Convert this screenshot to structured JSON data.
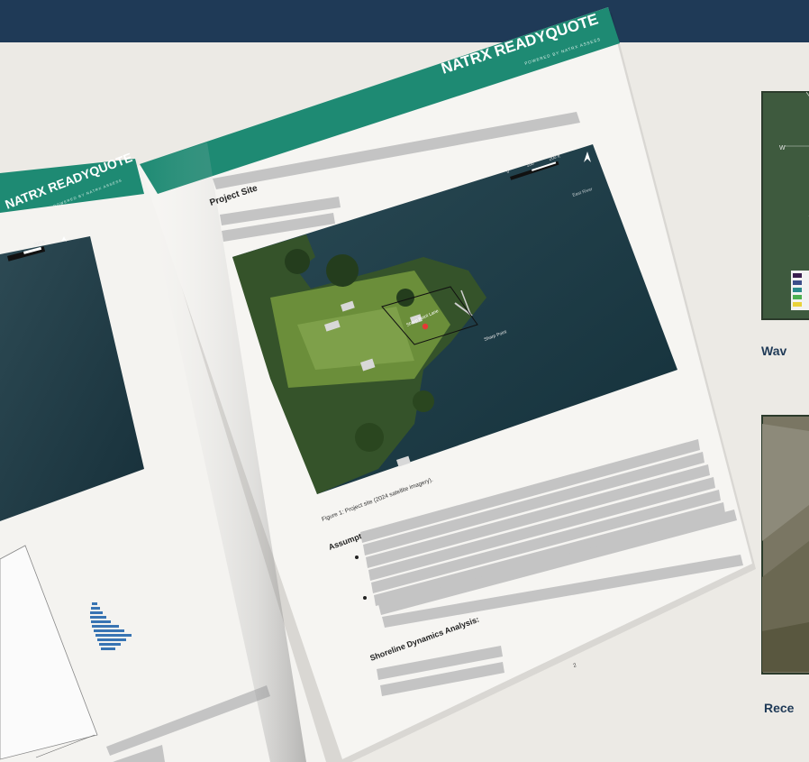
{
  "left_page": {
    "brand": "NATRX READYQUOTE",
    "brand_sub": "POWERED BY NATRX ASSESS",
    "scale_label": "200 ft"
  },
  "right_page": {
    "brand": "NATRX READYQUOTE",
    "brand_sub": "POWERED BY NATRX ASSESS",
    "section_project_site": "Project Site",
    "map_scale_zero": "0",
    "map_scale_mid": "100",
    "map_scale_end": "200 ft",
    "map_label_river": "East River",
    "map_label_point": "Sharp Point",
    "map_label_lane": "Sharp Point Lane",
    "figure_caption": "Figure 1: Project site (2024 satellite imagery).",
    "section_assumptions": "Assumptions",
    "section_shoreline": "Shoreline Dynamics Analysis:",
    "page_number": "2"
  },
  "side_cards": {
    "wave_caption": "Wav",
    "recent_caption": "Rece",
    "compass_w": "W"
  },
  "colors": {
    "header": "#1f3a57",
    "band": "#1e8a73",
    "placeholder": "#c4c4c4",
    "background": "#eceae5"
  }
}
